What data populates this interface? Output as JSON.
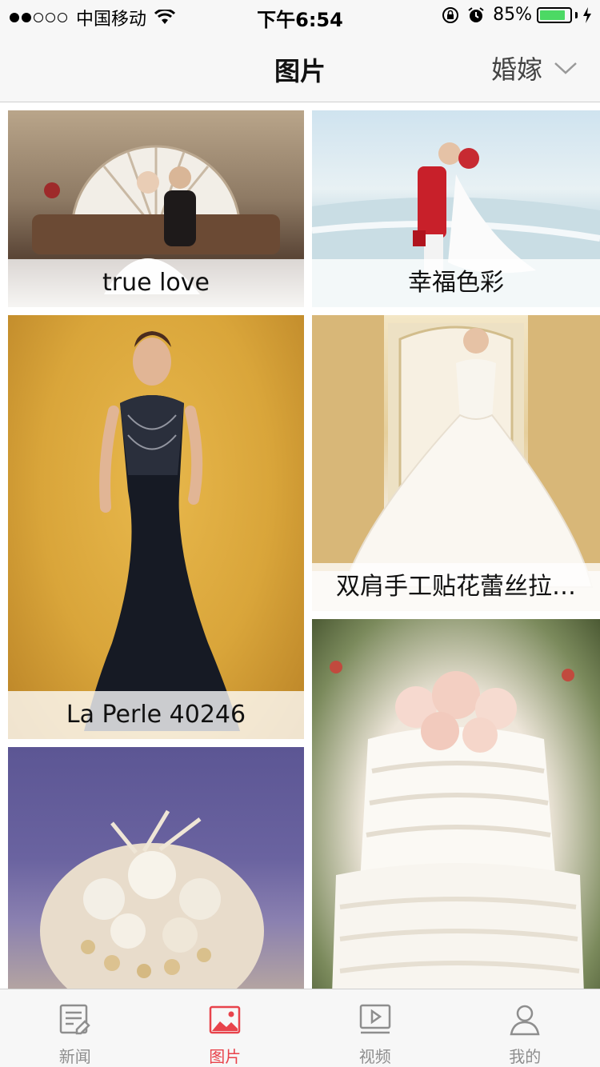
{
  "status_bar": {
    "carrier": "中国移动",
    "time": "下午6:54",
    "battery_percent": "85%",
    "battery_level": 0.85,
    "signal_bars_filled": 2,
    "signal_bars_total": 5
  },
  "nav": {
    "title": "图片",
    "filter_label": "婚嫁",
    "filter_icon": "chevron-down-icon"
  },
  "gallery": {
    "items": [
      {
        "caption": "true love"
      },
      {
        "caption": "幸福色彩"
      },
      {
        "caption": "La Perle 40246"
      },
      {
        "caption": "双肩手工贴花蕾丝拉…"
      },
      {
        "caption": ""
      },
      {
        "caption": ""
      }
    ]
  },
  "tabbar": {
    "active_color": "#e8434b",
    "inactive_color": "#8e8e8e",
    "tabs": [
      {
        "label": "新闻",
        "icon": "news-icon",
        "active": false
      },
      {
        "label": "图片",
        "icon": "picture-icon",
        "active": true
      },
      {
        "label": "视频",
        "icon": "video-icon",
        "active": false
      },
      {
        "label": "我的",
        "icon": "user-icon",
        "active": false
      }
    ]
  }
}
